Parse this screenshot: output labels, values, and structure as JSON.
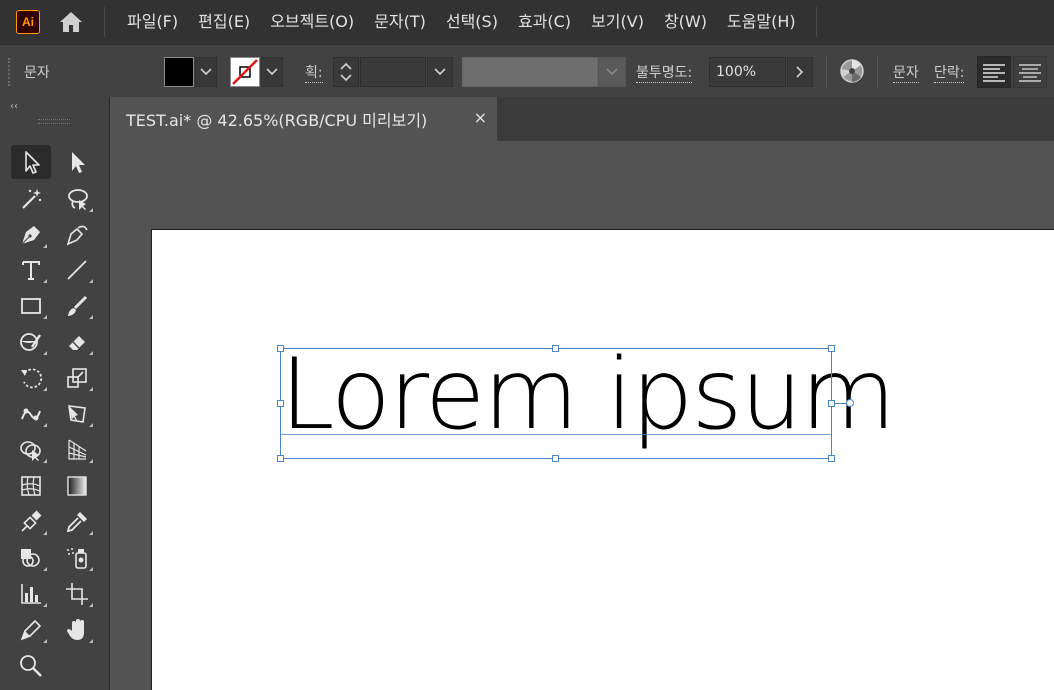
{
  "app": {
    "logo_text": "Ai",
    "logo_colors": {
      "bg": "#330000",
      "fg": "#ff9a00"
    }
  },
  "menu": {
    "items": [
      "파일(F)",
      "편집(E)",
      "오브젝트(O)",
      "문자(T)",
      "선택(S)",
      "효과(C)",
      "보기(V)",
      "창(W)",
      "도움말(H)"
    ]
  },
  "control_bar": {
    "context_label": "문자",
    "fill_color": "#000000",
    "stroke": "none",
    "stroke_weight_label": "획:",
    "stroke_weight_value": "",
    "opacity_label": "불투명도:",
    "opacity_value": "100%",
    "character_label": "문자",
    "paragraph_label": "단락:",
    "align_left_active": true
  },
  "tools_panel": {
    "collapse_label": "‹‹",
    "tools": [
      {
        "name": "selection-tool",
        "icon": "selection-arrow-icon",
        "active": true
      },
      {
        "name": "direct-selection-tool",
        "icon": "direct-selection-arrow-icon"
      },
      {
        "name": "magic-wand-tool",
        "icon": "magic-wand-icon"
      },
      {
        "name": "lasso-tool",
        "icon": "lasso-icon"
      },
      {
        "name": "pen-tool",
        "icon": "pen-icon"
      },
      {
        "name": "curvature-tool",
        "icon": "curvature-pen-icon"
      },
      {
        "name": "type-tool",
        "icon": "type-icon"
      },
      {
        "name": "line-tool",
        "icon": "line-segment-icon"
      },
      {
        "name": "rectangle-tool",
        "icon": "rectangle-icon"
      },
      {
        "name": "paintbrush-tool",
        "icon": "paintbrush-icon"
      },
      {
        "name": "shaper-tool",
        "icon": "shaper-icon"
      },
      {
        "name": "eraser-tool",
        "icon": "eraser-icon"
      },
      {
        "name": "rotate-tool",
        "icon": "rotate-icon"
      },
      {
        "name": "scale-tool",
        "icon": "scale-icon"
      },
      {
        "name": "puppet-warp-tool",
        "icon": "warp-icon"
      },
      {
        "name": "free-transform-tool",
        "icon": "free-transform-icon"
      },
      {
        "name": "shape-builder-tool",
        "icon": "shape-builder-icon"
      },
      {
        "name": "perspective-grid-tool",
        "icon": "perspective-grid-icon"
      },
      {
        "name": "mesh-tool",
        "icon": "mesh-icon"
      },
      {
        "name": "gradient-tool",
        "icon": "gradient-icon"
      },
      {
        "name": "eyedropper-tool",
        "icon": "eyedropper-icon"
      },
      {
        "name": "blend-tool",
        "icon": "blend-icon"
      },
      {
        "name": "live-paint-tool",
        "icon": "live-paint-icon"
      },
      {
        "name": "symbol-sprayer-tool",
        "icon": "symbol-sprayer-icon"
      },
      {
        "name": "column-graph-tool",
        "icon": "column-graph-icon"
      },
      {
        "name": "artboard-tool",
        "icon": "artboard-icon"
      },
      {
        "name": "slice-tool",
        "icon": "slice-knife-icon"
      },
      {
        "name": "hand-tool",
        "icon": "hand-icon"
      },
      {
        "name": "zoom-tool",
        "icon": "zoom-magnifier-icon"
      }
    ]
  },
  "document": {
    "tab_title": "TEST.ai* @ 42.65%(RGB/CPU 미리보기)",
    "close_glyph": "×"
  },
  "artboard": {
    "text": "Lorem ipsum",
    "selection_color": "#4a86c8"
  }
}
